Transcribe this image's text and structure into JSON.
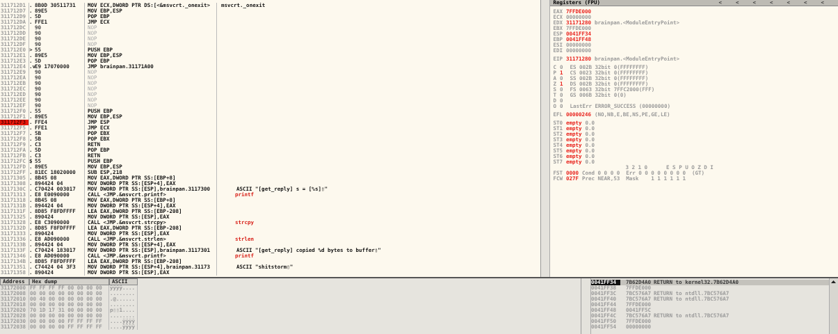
{
  "disasm": {
    "rows": [
      {
        "address": "311712D1",
        "marker": ".",
        "hex": "8B0D 30511731",
        "instruction": "MOV ECX,DWORD PTR DS:[<&msvcrt._onexit>",
        "kind": "code",
        "selected": false,
        "comment": {
          "text": "msvcrt._onexit",
          "kind": "string"
        }
      },
      {
        "address": "311712D7",
        "marker": ".",
        "hex": "89E5",
        "instruction": "MOV EBP,ESP",
        "kind": "code",
        "selected": false
      },
      {
        "address": "311712D9",
        "marker": ".",
        "hex": "5D",
        "instruction": "POP EBP",
        "kind": "code",
        "selected": false
      },
      {
        "address": "311712DA",
        "marker": ".",
        "hex": "FFE1",
        "instruction": "JMP ECX",
        "kind": "code",
        "selected": false
      },
      {
        "address": "311712DC",
        "hex": "90",
        "instruction": "NOP",
        "kind": "filler",
        "selected": false
      },
      {
        "address": "311712DD",
        "hex": "90",
        "instruction": "NOP",
        "kind": "filler",
        "selected": false
      },
      {
        "address": "311712DE",
        "hex": "90",
        "instruction": "NOP",
        "kind": "filler",
        "selected": false
      },
      {
        "address": "311712DF",
        "hex": "90",
        "instruction": "NOP",
        "kind": "filler",
        "selected": false
      },
      {
        "address": "311712E0",
        "marker": ">",
        "hex": "55",
        "instruction": "PUSH EBP",
        "kind": "code",
        "selected": false
      },
      {
        "address": "311712E1",
        "marker": ".",
        "hex": "89E5",
        "instruction": "MOV EBP,ESP",
        "kind": "code",
        "selected": false
      },
      {
        "address": "311712E3",
        "marker": ".",
        "hex": "5D",
        "instruction": "POP EBP",
        "kind": "code",
        "selected": false
      },
      {
        "address": "311712E4",
        "marker": ".v",
        "hex": "E9 17070000",
        "instruction": "JMP brainpan.31171A00",
        "kind": "code",
        "selected": false
      },
      {
        "address": "311712E9",
        "hex": "90",
        "instruction": "NOP",
        "kind": "filler",
        "selected": false
      },
      {
        "address": "311712EA",
        "hex": "90",
        "instruction": "NOP",
        "kind": "filler",
        "selected": false
      },
      {
        "address": "311712EB",
        "hex": "90",
        "instruction": "NOP",
        "kind": "filler",
        "selected": false
      },
      {
        "address": "311712EC",
        "hex": "90",
        "instruction": "NOP",
        "kind": "filler",
        "selected": false
      },
      {
        "address": "311712ED",
        "hex": "90",
        "instruction": "NOP",
        "kind": "filler",
        "selected": false
      },
      {
        "address": "311712EE",
        "hex": "90",
        "instruction": "NOP",
        "kind": "filler",
        "selected": false
      },
      {
        "address": "311712EF",
        "hex": "90",
        "instruction": "NOP",
        "kind": "filler",
        "selected": false
      },
      {
        "address": "311712F0",
        "marker": ".",
        "hex": "55",
        "instruction": "PUSH EBP",
        "kind": "code",
        "selected": false
      },
      {
        "address": "311712F1",
        "marker": ".",
        "hex": "89E5",
        "instruction": "MOV EBP,ESP",
        "kind": "code",
        "selected": false
      },
      {
        "address": "311712F3",
        "marker": ".",
        "hex": "FFE4",
        "instruction": "JMP ESP",
        "kind": "code",
        "selected": true
      },
      {
        "address": "311712F5",
        "marker": ".",
        "hex": "FFE1",
        "instruction": "JMP ECX",
        "kind": "code",
        "selected": false
      },
      {
        "address": "311712F7",
        "marker": ".",
        "hex": "5B",
        "instruction": "POP EBX",
        "kind": "code",
        "selected": false
      },
      {
        "address": "311712F8",
        "marker": ".",
        "hex": "5B",
        "instruction": "POP EBX",
        "kind": "code",
        "selected": false
      },
      {
        "address": "311712F9",
        "marker": ".",
        "hex": "C3",
        "instruction": "RETN",
        "kind": "code",
        "selected": false
      },
      {
        "address": "311712FA",
        "marker": ".",
        "hex": "5D",
        "instruction": "POP EBP",
        "kind": "code",
        "selected": false
      },
      {
        "address": "311712FB",
        "marker": ".",
        "hex": "C3",
        "instruction": "RETN",
        "kind": "code",
        "selected": false
      },
      {
        "address": "311712FC",
        "marker": "$",
        "hex": "55",
        "instruction": "PUSH EBP",
        "kind": "code",
        "selected": false
      },
      {
        "address": "311712FD",
        "marker": ".",
        "hex": "89E5",
        "instruction": "MOV EBP,ESP",
        "kind": "code",
        "selected": false
      },
      {
        "address": "311712FF",
        "marker": ".",
        "hex": "81EC 18020000",
        "instruction": "SUB ESP,218",
        "kind": "code",
        "selected": false
      },
      {
        "address": "31171305",
        "marker": ".",
        "hex": "8B45 08",
        "instruction": "MOV EAX,DWORD PTR SS:[EBP+8]",
        "kind": "code",
        "selected": false
      },
      {
        "address": "31171308",
        "marker": ".",
        "hex": "894424 04",
        "instruction": "MOV DWORD PTR SS:[ESP+4],EAX",
        "kind": "code",
        "selected": false
      },
      {
        "address": "3117130C",
        "marker": ".",
        "hex": "C70424 003017",
        "instruction": "MOV DWORD PTR SS:[ESP],brainpan.3117300",
        "kind": "code",
        "selected": false,
        "comment": {
          "text": "ASCII \"[get_reply] s = [%s]▯\"",
          "kind": "string"
        }
      },
      {
        "address": "31171313",
        "marker": ".",
        "hex": "E8 E0090000",
        "instruction": "CALL <JMP.&msvcrt.printf>",
        "kind": "code",
        "selected": false,
        "comment": {
          "text": "printf",
          "kind": "call"
        }
      },
      {
        "address": "31171318",
        "marker": ".",
        "hex": "8B45 08",
        "instruction": "MOV EAX,DWORD PTR SS:[EBP+8]",
        "kind": "code",
        "selected": false
      },
      {
        "address": "3117131B",
        "marker": ".",
        "hex": "894424 04",
        "instruction": "MOV DWORD PTR SS:[ESP+4],EAX",
        "kind": "code",
        "selected": false
      },
      {
        "address": "3117131F",
        "marker": ".",
        "hex": "8D85 F8FDFFFF",
        "instruction": "LEA EAX,DWORD PTR SS:[EBP-208]",
        "kind": "code",
        "selected": false
      },
      {
        "address": "31171325",
        "marker": ".",
        "hex": "890424",
        "instruction": "MOV DWORD PTR SS:[ESP],EAX",
        "kind": "code",
        "selected": false
      },
      {
        "address": "31171328",
        "marker": ".",
        "hex": "E8 C3090000",
        "instruction": "CALL <JMP.&msvcrt.strcpy>",
        "kind": "code",
        "selected": false,
        "comment": {
          "text": "strcpy",
          "kind": "call"
        }
      },
      {
        "address": "3117132D",
        "marker": ".",
        "hex": "8D85 F8FDFFFF",
        "instruction": "LEA EAX,DWORD PTR SS:[EBP-208]",
        "kind": "code",
        "selected": false
      },
      {
        "address": "31171333",
        "marker": ".",
        "hex": "890424",
        "instruction": "MOV DWORD PTR SS:[ESP],EAX",
        "kind": "code",
        "selected": false
      },
      {
        "address": "31171336",
        "marker": ".",
        "hex": "E8 AD090000",
        "instruction": "CALL <JMP.&msvcrt.strlen>",
        "kind": "code",
        "selected": false,
        "comment": {
          "text": "strlen",
          "kind": "call"
        }
      },
      {
        "address": "3117133B",
        "marker": ".",
        "hex": "894424 04",
        "instruction": "MOV DWORD PTR SS:[ESP+4],EAX",
        "kind": "code",
        "selected": false
      },
      {
        "address": "3117133F",
        "marker": ".",
        "hex": "C70424 183017",
        "instruction": "MOV DWORD PTR SS:[ESP],brainpan.3117301",
        "kind": "code",
        "selected": false,
        "comment": {
          "text": "ASCII \"[get_reply] copied %d bytes to buffer▯\"",
          "kind": "string"
        }
      },
      {
        "address": "31171346",
        "marker": ".",
        "hex": "E8 AD090000",
        "instruction": "CALL <JMP.&msvcrt.printf>",
        "kind": "code",
        "selected": false,
        "comment": {
          "text": "printf",
          "kind": "call"
        }
      },
      {
        "address": "3117134B",
        "marker": ".",
        "hex": "8D85 F8FDFFFF",
        "instruction": "LEA EAX,DWORD PTR SS:[EBP-208]",
        "kind": "code",
        "selected": false
      },
      {
        "address": "31171351",
        "marker": ".",
        "hex": "C74424 04 3F3",
        "instruction": "MOV DWORD PTR SS:[ESP+4],brainpan.31173",
        "kind": "code",
        "selected": false,
        "comment": {
          "text": "ASCII \"shitstorm▯\"",
          "kind": "string"
        }
      },
      {
        "address": "31171358",
        "marker": ".",
        "hex": "890424",
        "instruction": "MOV DWORD PTR SS:[ESP],EAX",
        "kind": "code",
        "selected": false
      }
    ]
  },
  "registers_panel": {
    "title": "Registers (FPU)",
    "header_buttons": [
      "<",
      "<",
      "<",
      "<",
      "<",
      "<",
      "<"
    ],
    "registers": [
      {
        "name": "EAX",
        "value": "7FFDE000",
        "changed": true
      },
      {
        "name": "ECX",
        "value": "00000000",
        "changed": false
      },
      {
        "name": "EDX",
        "value": "31171280",
        "changed": true,
        "comment": "brainpan.<ModuleEntryPoint>"
      },
      {
        "name": "EBX",
        "value": "7FFDE000",
        "changed": false
      },
      {
        "name": "ESP",
        "value": "0041FF34",
        "changed": true
      },
      {
        "name": "EBP",
        "value": "0041FF48",
        "changed": true
      },
      {
        "name": "ESI",
        "value": "00000000",
        "changed": false
      },
      {
        "name": "EDI",
        "value": "00000000",
        "changed": false
      }
    ],
    "eip": {
      "name": "EIP",
      "value": "31171280",
      "changed": true,
      "comment": "brainpan.<ModuleEntryPoint>"
    },
    "flags": [
      {
        "flag": "C",
        "value": "0",
        "changed": false,
        "detail": "ES 002B 32bit 0(FFFFFFFF)"
      },
      {
        "flag": "P",
        "value": "1",
        "changed": true,
        "detail": "CS 0023 32bit 0(FFFFFFFF)"
      },
      {
        "flag": "A",
        "value": "0",
        "changed": false,
        "detail": "SS 002B 32bit 0(FFFFFFFF)"
      },
      {
        "flag": "Z",
        "value": "1",
        "changed": true,
        "detail": "DS 002B 32bit 0(FFFFFFFF)"
      },
      {
        "flag": "S",
        "value": "0",
        "changed": false,
        "detail": "FS 0063 32bit 7FFC2000(FFF)"
      },
      {
        "flag": "T",
        "value": "0",
        "changed": false,
        "detail": "GS 006B 32bit 0(0)"
      },
      {
        "flag": "D",
        "value": "0",
        "changed": false
      },
      {
        "flag": "O",
        "value": "0",
        "changed": false,
        "detail": "LastErr ERROR_SUCCESS (00000000)"
      }
    ],
    "efl": {
      "name": "EFL",
      "value": "00000246",
      "changed": true,
      "comment": "(NO,NB,E,BE,NS,PE,GE,LE)"
    },
    "fpu": [
      {
        "name": "ST0",
        "tag": "empty",
        "value": "0.0"
      },
      {
        "name": "ST1",
        "tag": "empty",
        "value": "0.0"
      },
      {
        "name": "ST2",
        "tag": "empty",
        "value": "0.0"
      },
      {
        "name": "ST3",
        "tag": "empty",
        "value": "0.0"
      },
      {
        "name": "ST4",
        "tag": "empty",
        "value": "0.0"
      },
      {
        "name": "ST5",
        "tag": "empty",
        "value": "0.0"
      },
      {
        "name": "ST6",
        "tag": "empty",
        "value": "0.0"
      },
      {
        "name": "ST7",
        "tag": "empty",
        "value": "0.0"
      }
    ],
    "fpu_bits_header": "3 2 1 0      E S P U O Z D I",
    "fst": {
      "name": "FST",
      "value": "0000",
      "changed": true,
      "detail": "Cond 0 0 0 0  Err 0 0 0 0 0 0 0 0  (GT)"
    },
    "fcw": {
      "name": "FCW",
      "value": "027F",
      "changed": true,
      "detail": "Prec NEAR,53  Mask    1 1 1 1 1 1"
    }
  },
  "dump": {
    "columns": [
      "Address",
      "Hex dump",
      "ASCII"
    ],
    "rows": [
      {
        "address": "31172000",
        "hex": "FF FF FF FF 00 00 00 00",
        "ascii": "ÿÿÿÿ...."
      },
      {
        "address": "31172008",
        "hex": "00 00 00 00 00 00 00 00",
        "ascii": "........"
      },
      {
        "address": "31172010",
        "hex": "00 40 00 00 00 00 00 00",
        "ascii": ".@......"
      },
      {
        "address": "31172018",
        "hex": "00 00 00 00 00 00 00 00",
        "ascii": "........"
      },
      {
        "address": "31172020",
        "hex": "70 1D 17 31 00 00 00 00",
        "ascii": "p▯▯1...."
      },
      {
        "address": "31172028",
        "hex": "00 00 00 00 00 00 00 00",
        "ascii": "........"
      },
      {
        "address": "31172030",
        "hex": "00 00 00 00 FF FF FF FF",
        "ascii": "....ÿÿÿÿ"
      },
      {
        "address": "31172038",
        "hex": "00 00 00 00 FF FF FF FF",
        "ascii": "....ÿÿÿÿ"
      }
    ]
  },
  "stack": {
    "rows": [
      {
        "address": "0041FF34",
        "value": "7B62D4A0",
        "comment": "RETURN to kernel32.7B62D4A0",
        "selected": true
      },
      {
        "address": "0041FF38",
        "value": "7FFDE000",
        "selected": false
      },
      {
        "address": "0041FF3C",
        "value": "7BC576A7",
        "comment": "RETURN to ntdll.7BC576A7",
        "selected": false
      },
      {
        "address": "0041FF40",
        "value": "7BC576A7",
        "comment": "RETURN to ntdll.7BC576A7",
        "selected": false
      },
      {
        "address": "0041FF44",
        "value": "7FFDE000",
        "selected": false
      },
      {
        "address": "0041FF48",
        "value": "0041FF5C",
        "selected": false
      },
      {
        "address": "0041FF4C",
        "value": "7BC576A7",
        "comment": "RETURN to ntdll.7BC576A7",
        "selected": false
      },
      {
        "address": "0041FF50",
        "value": "7FFDE000",
        "selected": false
      },
      {
        "address": "0041FF54",
        "value": "00000000",
        "selected": false
      }
    ]
  }
}
